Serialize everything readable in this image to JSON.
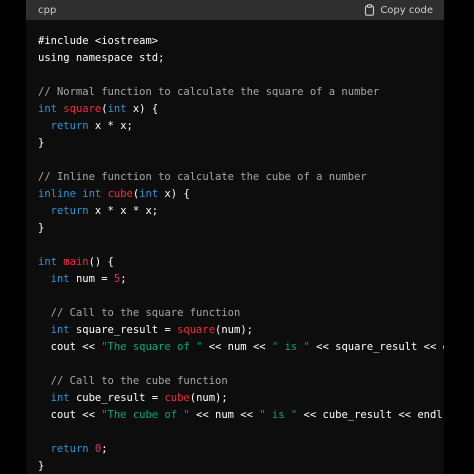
{
  "header": {
    "language": "cpp",
    "copy_label": "Copy code",
    "copy_icon": "clipboard-icon"
  },
  "colors": {
    "page_background": "#000000",
    "code_background": "#0d0d0d",
    "header_background": "#2f2f2f",
    "plain": "#ffffff",
    "comment": "#a8a8a8",
    "keyword": "#2e95d3",
    "function": "#f22c3d",
    "string": "#00a67d",
    "number": "#df3079"
  },
  "code": {
    "lines": [
      [
        {
          "t": "#include <iostream>",
          "c": "plain"
        }
      ],
      [
        {
          "t": "using namespace std;",
          "c": "plain"
        }
      ],
      [],
      [
        {
          "t": "// Normal function to calculate the square of a number",
          "c": "comment"
        }
      ],
      [
        {
          "t": "int",
          "c": "keyword"
        },
        {
          "t": " ",
          "c": "plain"
        },
        {
          "t": "square",
          "c": "func"
        },
        {
          "t": "(",
          "c": "plain"
        },
        {
          "t": "int",
          "c": "keyword"
        },
        {
          "t": " x) {",
          "c": "plain"
        }
      ],
      [
        {
          "t": "  ",
          "c": "plain"
        },
        {
          "t": "return",
          "c": "keyword"
        },
        {
          "t": " x * x;",
          "c": "plain"
        }
      ],
      [
        {
          "t": "}",
          "c": "plain"
        }
      ],
      [],
      [
        {
          "t": "// Inline function to calculate the cube of a number",
          "c": "comment"
        }
      ],
      [
        {
          "t": "inline",
          "c": "keyword"
        },
        {
          "t": " ",
          "c": "plain"
        },
        {
          "t": "int",
          "c": "keyword"
        },
        {
          "t": " ",
          "c": "plain"
        },
        {
          "t": "cube",
          "c": "func"
        },
        {
          "t": "(",
          "c": "plain"
        },
        {
          "t": "int",
          "c": "keyword"
        },
        {
          "t": " x) {",
          "c": "plain"
        }
      ],
      [
        {
          "t": "  ",
          "c": "plain"
        },
        {
          "t": "return",
          "c": "keyword"
        },
        {
          "t": " x * x * x;",
          "c": "plain"
        }
      ],
      [
        {
          "t": "}",
          "c": "plain"
        }
      ],
      [],
      [
        {
          "t": "int",
          "c": "keyword"
        },
        {
          "t": " ",
          "c": "plain"
        },
        {
          "t": "main",
          "c": "func"
        },
        {
          "t": "() {",
          "c": "plain"
        }
      ],
      [
        {
          "t": "  ",
          "c": "plain"
        },
        {
          "t": "int",
          "c": "keyword"
        },
        {
          "t": " num = ",
          "c": "plain"
        },
        {
          "t": "5",
          "c": "number"
        },
        {
          "t": ";",
          "c": "plain"
        }
      ],
      [],
      [
        {
          "t": "  ",
          "c": "plain"
        },
        {
          "t": "// Call to the square function",
          "c": "comment"
        }
      ],
      [
        {
          "t": "  ",
          "c": "plain"
        },
        {
          "t": "int",
          "c": "keyword"
        },
        {
          "t": " square_result = ",
          "c": "plain"
        },
        {
          "t": "square",
          "c": "func"
        },
        {
          "t": "(num);",
          "c": "plain"
        }
      ],
      [
        {
          "t": "  cout << ",
          "c": "plain"
        },
        {
          "t": "\"The square of \"",
          "c": "string"
        },
        {
          "t": " << num << ",
          "c": "plain"
        },
        {
          "t": "\" is \"",
          "c": "string"
        },
        {
          "t": " << square_result << endl",
          "c": "plain"
        }
      ],
      [],
      [
        {
          "t": "  ",
          "c": "plain"
        },
        {
          "t": "// Call to the cube function",
          "c": "comment"
        }
      ],
      [
        {
          "t": "  ",
          "c": "plain"
        },
        {
          "t": "int",
          "c": "keyword"
        },
        {
          "t": " cube_result = ",
          "c": "plain"
        },
        {
          "t": "cube",
          "c": "func"
        },
        {
          "t": "(num);",
          "c": "plain"
        }
      ],
      [
        {
          "t": "  cout << ",
          "c": "plain"
        },
        {
          "t": "\"The cube of \"",
          "c": "string"
        },
        {
          "t": " << num << ",
          "c": "plain"
        },
        {
          "t": "\" is \"",
          "c": "string"
        },
        {
          "t": " << cube_result << endl;",
          "c": "plain"
        }
      ],
      [],
      [
        {
          "t": "  ",
          "c": "plain"
        },
        {
          "t": "return",
          "c": "keyword"
        },
        {
          "t": " ",
          "c": "plain"
        },
        {
          "t": "0",
          "c": "number"
        },
        {
          "t": ";",
          "c": "plain"
        }
      ],
      [
        {
          "t": "}",
          "c": "plain"
        }
      ]
    ]
  }
}
